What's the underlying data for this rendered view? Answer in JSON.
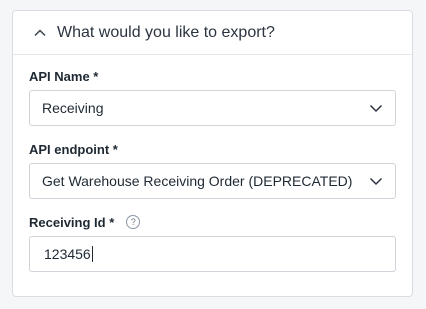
{
  "export_panel": {
    "title": "What would you like to export?",
    "collapse_icon": "chevron-up-icon"
  },
  "fields": {
    "api_name": {
      "label": "API Name *",
      "value": "Receiving",
      "icon": "chevron-down-icon"
    },
    "api_endpoint": {
      "label": "API endpoint *",
      "value": "Get Warehouse Receiving Order (DEPRECATED)",
      "icon": "chevron-down-icon"
    },
    "receiving_id": {
      "label": "Receiving Id *",
      "help_glyph": "?",
      "value": "123456"
    }
  }
}
